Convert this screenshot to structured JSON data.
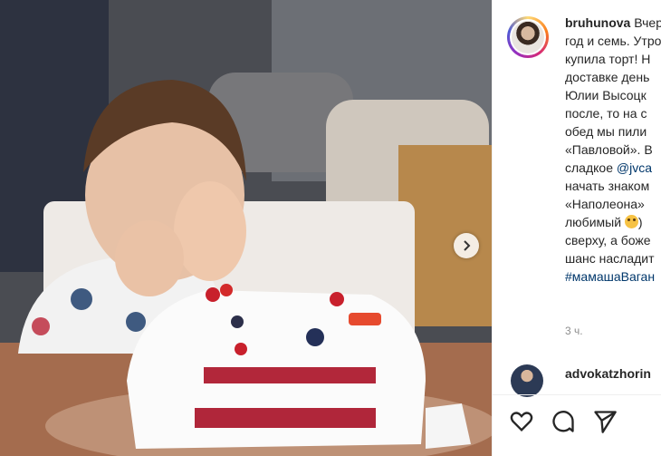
{
  "post": {
    "user": "bruhunova",
    "caption_lines": [
      "Вчера",
      "год и семь. Утром",
      "купила торт! Н",
      "доставке день",
      "Юлии Высоцк",
      "после, то на с",
      "обед мы пили",
      "«Павловой». В",
      "сладкое",
      "начать знаком",
      "«Наполеона»",
      "любимый",
      "сверху, а боже",
      "шанс насладит",
      "#мамашаВаган"
    ],
    "caption_mention": "@jvca",
    "timestamp": "3 ч."
  },
  "comment": {
    "user": "advokatzhorin"
  },
  "icons": {
    "next": "chevron-right-icon",
    "like": "heart-icon",
    "comment": "speech-bubble-icon",
    "share": "paper-plane-icon",
    "emoji": "worried-face-emoji"
  },
  "colors": {
    "text": "#262626",
    "link": "#00376b",
    "muted": "#8e8e8e"
  }
}
